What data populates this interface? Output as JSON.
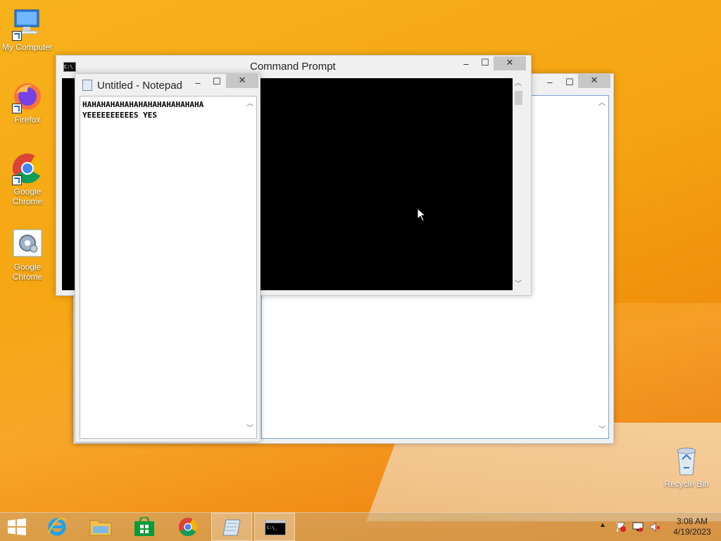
{
  "desktop": {
    "icons": [
      {
        "label": "My Computer",
        "icon": "computer-icon"
      },
      {
        "label": "Firefox",
        "icon": "firefox-icon"
      },
      {
        "label": "Google Chrome",
        "icon": "chrome-icon"
      },
      {
        "label": "Google Chrome",
        "icon": "settings-gear-icon"
      },
      {
        "label": "Recycle Bin",
        "icon": "recycle-bin-icon"
      }
    ]
  },
  "windows": {
    "cmd": {
      "title": "Command Prompt"
    },
    "notepad": {
      "title": "Untitled - Notepad",
      "lines": [
        "HAHAHAHAHAHAHAHAHAHAHAHAHA",
        "YEEEEEEEEEES YES"
      ]
    }
  },
  "controls": {
    "minimize": "–",
    "maximize": "☐",
    "close": "✕"
  },
  "taskbar": {
    "items": [
      "start",
      "internet-explorer",
      "file-explorer",
      "store",
      "chrome",
      "notepad",
      "command-prompt"
    ],
    "time": "3:08 AM",
    "date": "4/19/2023"
  },
  "colors": {
    "accent": "#f5a411",
    "cmd_bg": "#000000"
  }
}
